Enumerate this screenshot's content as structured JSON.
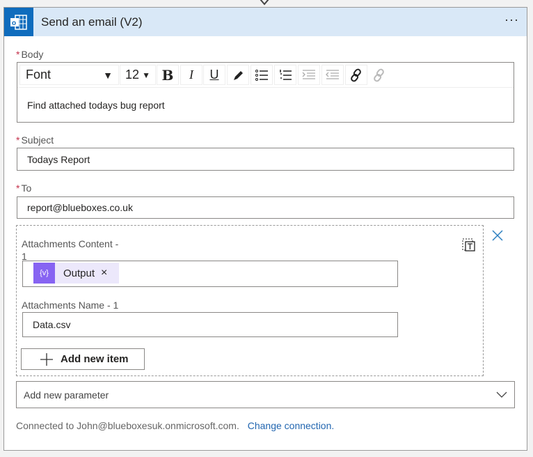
{
  "header": {
    "title": "Send an email (V2)",
    "more": "···"
  },
  "body": {
    "label": "Body",
    "font": "Font",
    "size": "12",
    "text": "Find attached todays bug report",
    "toolbar": {
      "bold": "B",
      "italic": "I",
      "underline": "U"
    }
  },
  "subject": {
    "label": "Subject",
    "value": "Todays Report"
  },
  "to": {
    "label": "To",
    "value": "report@blueboxes.co.uk"
  },
  "attachments": {
    "content_label": "Attachments Content -",
    "content_label_2": "1",
    "chip": "Output",
    "chip_remove": "×",
    "name_label": "Attachments Name - 1",
    "name_value": "Data.csv",
    "add_item": "Add new item"
  },
  "add_param": "Add new parameter",
  "footer": {
    "connected": "Connected to John@blueboxesuk.onmicrosoft.com.",
    "change": "Change connection."
  },
  "colors": {
    "accent": "#0f6cbd",
    "header": "#d9e8f7",
    "chip": "#8764f2"
  }
}
